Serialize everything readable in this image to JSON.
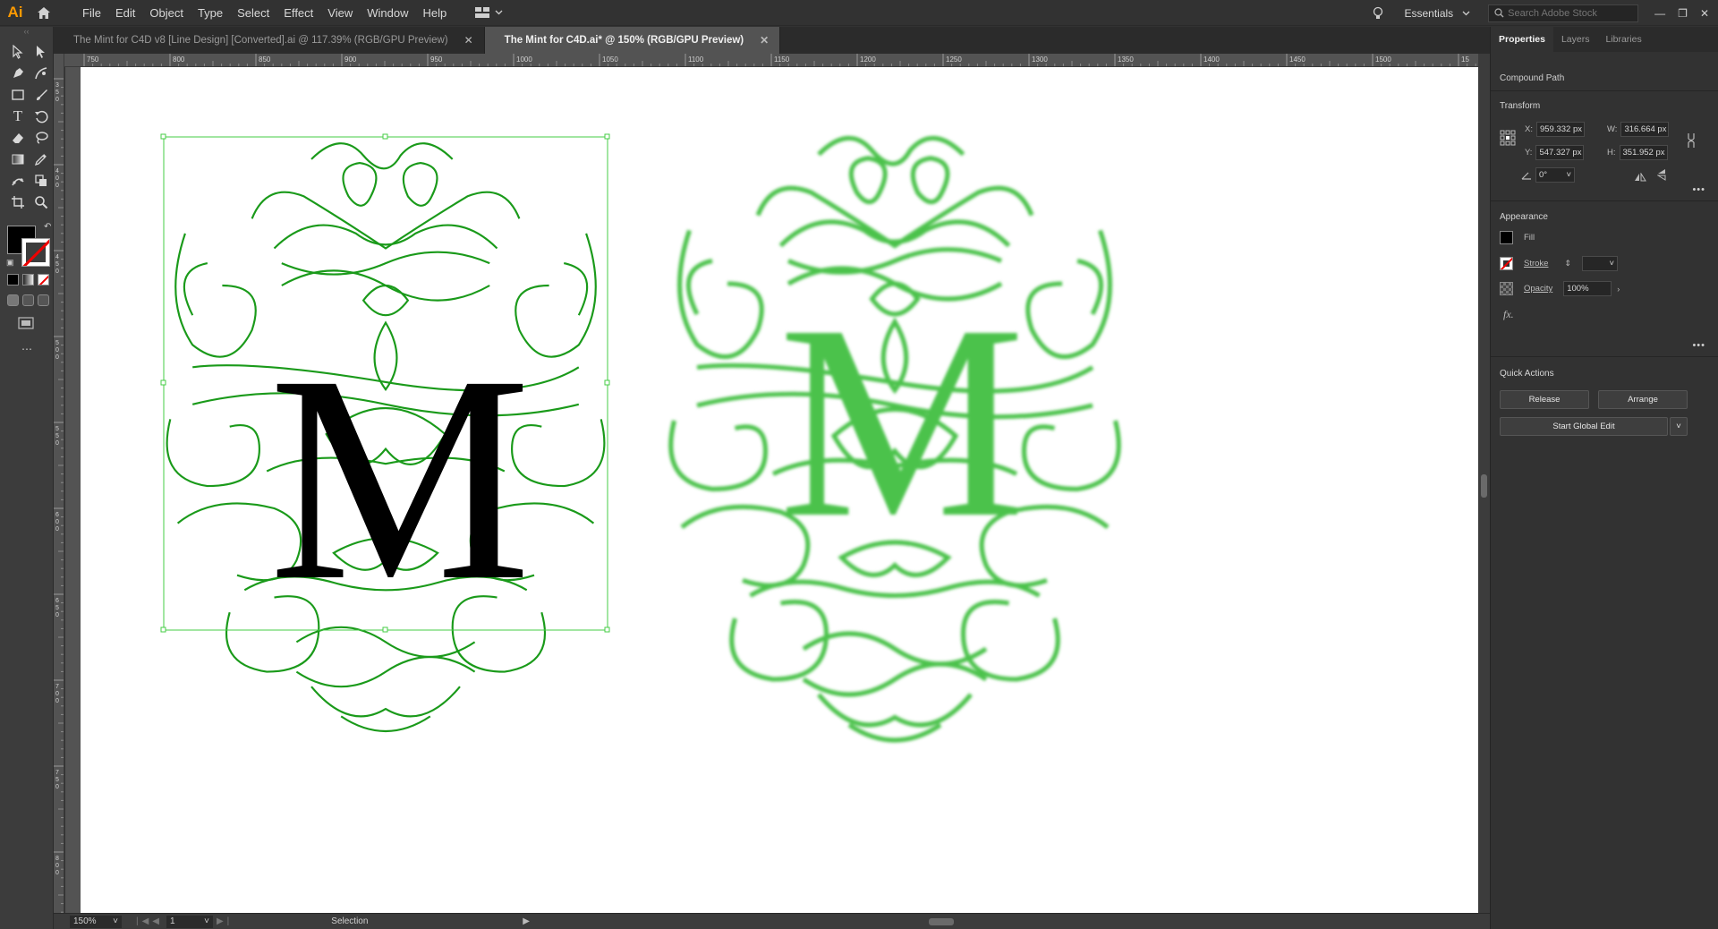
{
  "app": {
    "logo": "Ai"
  },
  "menu": [
    "File",
    "Edit",
    "Object",
    "Type",
    "Select",
    "Effect",
    "View",
    "Window",
    "Help"
  ],
  "workspace": "Essentials",
  "search": {
    "placeholder": "Search Adobe Stock"
  },
  "tabs": [
    {
      "label": "The Mint for C4D v8 [Line Design] [Converted].ai @ 117.39% (RGB/GPU Preview)",
      "active": false
    },
    {
      "label": "The Mint for C4D.ai* @ 150% (RGB/GPU Preview)",
      "active": true
    }
  ],
  "ruler_top_ticks": [
    "750",
    "800",
    "850",
    "900",
    "950",
    "1000",
    "1050",
    "1100",
    "1150",
    "1200",
    "1250",
    "1300",
    "1350",
    "1400",
    "1450",
    "1500",
    "15"
  ],
  "ruler_left_ticks": [
    "350",
    "400",
    "450",
    "500",
    "550",
    "600",
    "650",
    "700",
    "750",
    "800"
  ],
  "status": {
    "zoom": "150%",
    "page": "1",
    "tool": "Selection"
  },
  "panel": {
    "tabs": [
      "Properties",
      "Layers",
      "Libraries"
    ],
    "object_type": "Compound Path",
    "transform": {
      "heading": "Transform",
      "x_label": "X:",
      "x": "959.332 px",
      "y_label": "Y:",
      "y": "547.327 px",
      "w_label": "W:",
      "w": "316.664 px",
      "h_label": "H:",
      "h": "351.952 px",
      "angle": "0°"
    },
    "appearance": {
      "heading": "Appearance",
      "fill": "Fill",
      "stroke": "Stroke",
      "opacity_label": "Opacity",
      "opacity": "100%",
      "fx": "fx."
    },
    "quick_actions": {
      "heading": "Quick Actions",
      "release": "Release",
      "arrange": "Arrange",
      "global_edit": "Start Global Edit"
    }
  },
  "colors": {
    "accent_orange": "#ff9a00",
    "selection_green": "#44cc44",
    "art_dark_green": "#1a9a1a",
    "art_light_green": "#4cc24c"
  }
}
